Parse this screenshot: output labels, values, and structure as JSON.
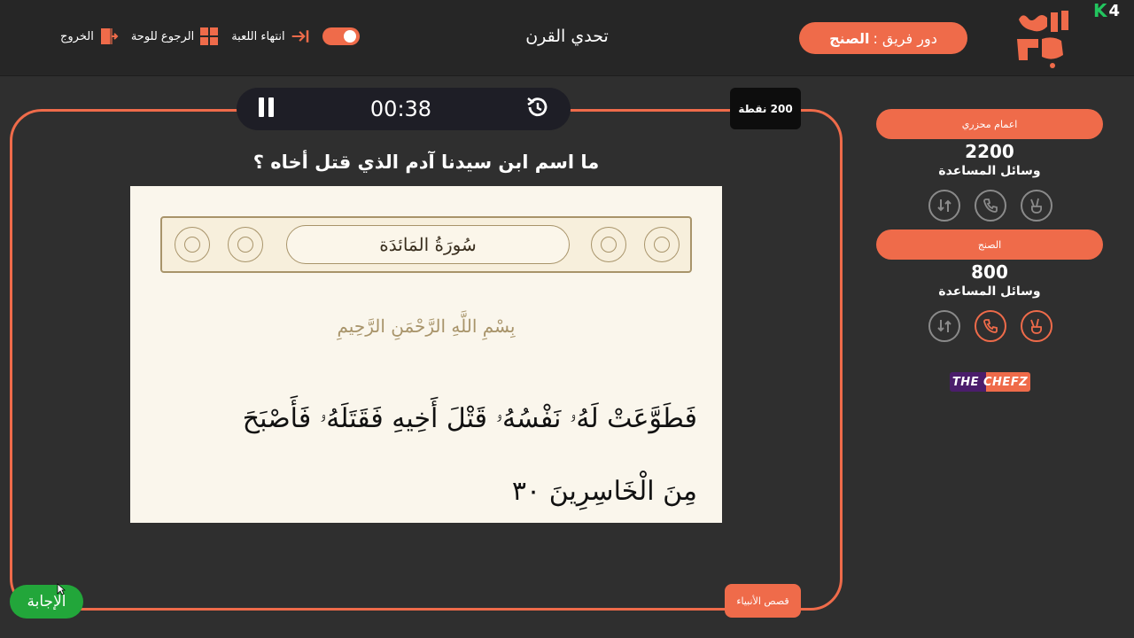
{
  "header": {
    "exit_label": "الخروج",
    "back_to_board_label": "الرجوع للوحة",
    "end_game_label": "انتهاء اللعبة",
    "title": "تحدي القرن",
    "turn_prefix": "دور فريق :",
    "turn_team": "الصنج",
    "logo_text": "سين جيم",
    "version_badge": "4"
  },
  "timer": {
    "time": "00:38"
  },
  "question": {
    "points": "200 نقطة",
    "text": "ما اسم ابن سيدنا آدم الذي قتل أخاه ؟",
    "surah_title": "سُورَةُ المَائدَة",
    "basmala": "بِسْمِ اللَّهِ الرَّحْمَنِ الرَّحِيمِ",
    "verse": "فَطَوَّعَتْ لَهُۥ نَفْسُهُۥ قَتْلَ أَخِيهِ فَقَتَلَهُۥ فَأَصْبَحَ مِنَ الْخَاسِرِينَ ٣٠",
    "category": "قصص الأنبياء",
    "answer_label": "الإجابة"
  },
  "teams": [
    {
      "name": "اعمام محزري",
      "score": "2200",
      "tools_label": "وسائل المساعدة"
    },
    {
      "name": "الصنج",
      "score": "800",
      "tools_label": "وسائل المساعدة"
    }
  ],
  "sponsor": {
    "text": "THE CHEFZ"
  },
  "colors": {
    "accent": "#ef6b4a",
    "answer": "#22a63a",
    "background": "#2f2f2f"
  }
}
